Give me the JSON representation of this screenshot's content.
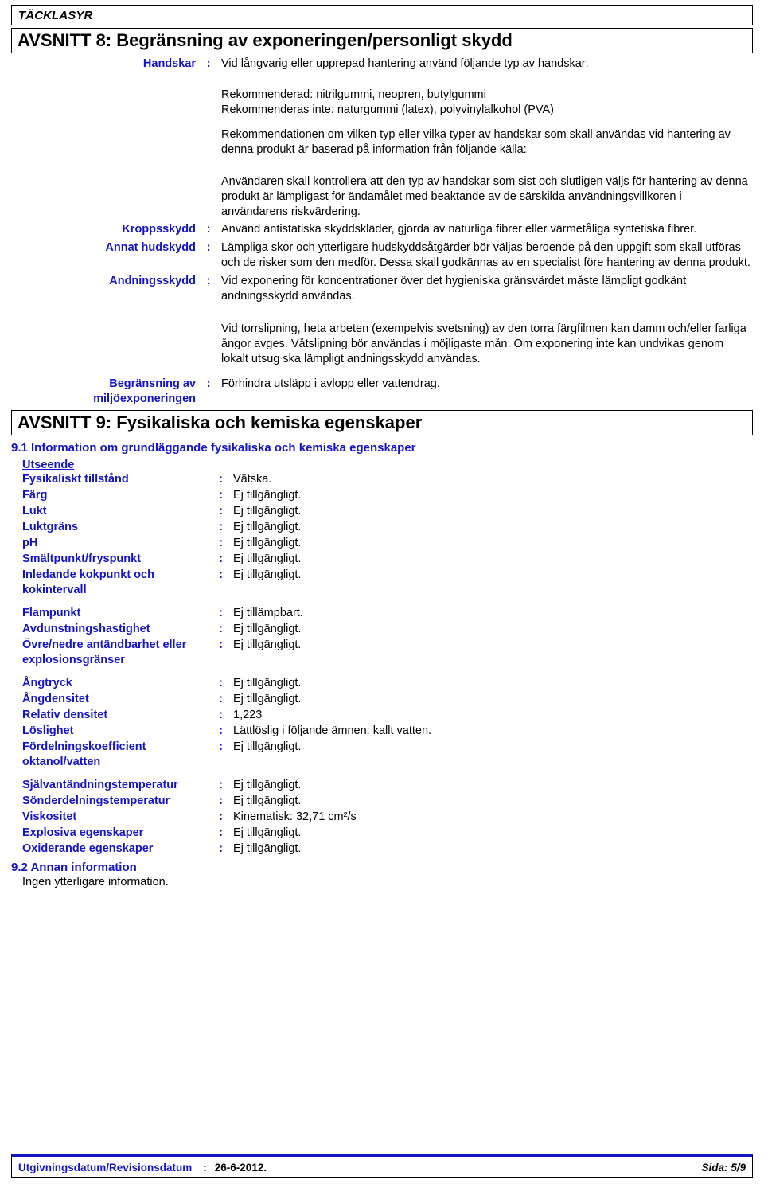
{
  "document": {
    "product_name": "TÄCKLASYR"
  },
  "section8": {
    "banner": "AVSNITT 8: Begränsning av exponeringen/personligt skydd",
    "colon": ":",
    "rows": [
      {
        "label": "Handskar",
        "value": "Vid långvarig eller upprepad hantering använd följande typ av handskar:"
      },
      {
        "label": "Kroppsskydd",
        "value": "Använd antistatiska skyddskläder, gjorda av naturliga fibrer eller värmetåliga syntetiska fibrer."
      },
      {
        "label": "Annat hudskydd",
        "value": "Lämpliga skor och ytterligare hudskyddsåtgärder bör väljas beroende på den uppgift som skall utföras och de risker som den medför. Dessa skall godkännas av en specialist före hantering av denna produkt."
      },
      {
        "label": "Andningsskydd",
        "value": "Vid exponering för koncentrationer över det hygieniska gränsvärdet måste lämpligt godkänt andningsskydd användas."
      },
      {
        "label": "Begränsning av miljöexponeringen",
        "value": "Förhindra utsläpp i avlopp eller vattendrag."
      }
    ],
    "handskar_note_1": "Rekommenderad: nitrilgummi, neopren, butylgummi\nRekommenderas inte: naturgummi (latex), polyvinylalkohol (PVA)",
    "handskar_note_2": "Rekommendationen om vilken typ eller vilka typer av handskar som skall användas vid hantering av denna produkt är baserad på information från följande källa:",
    "handskar_note_3": "Användaren skall kontrollera att den typ av handskar som sist och slutligen väljs för hantering av denna produkt är lämpligast för ändamålet med beaktande av de särskilda användningsvillkoren i användarens riskvärdering.",
    "andnings_note": "Vid torrslipning, heta arbeten (exempelvis svetsning) av den torra färgfilmen kan damm och/eller farliga ångor avges. Våtslipning bör användas i möjligaste mån. Om exponering inte kan undvikas genom lokalt utsug ska lämpligt andningsskydd användas."
  },
  "section9": {
    "banner": "AVSNITT 9: Fysikaliska och kemiska egenskaper",
    "subheading_91": "9.1 Information om grundläggande fysikaliska och kemiska egenskaper",
    "appearance_heading": "Utseende",
    "colon": ":",
    "properties": [
      {
        "label": "Fysikaliskt tillstånd",
        "value": "Vätska."
      },
      {
        "label": "Färg",
        "value": "Ej tillgängligt."
      },
      {
        "label": "Lukt",
        "value": "Ej tillgängligt."
      },
      {
        "label": "Luktgräns",
        "value": "Ej tillgängligt."
      },
      {
        "label": "pH",
        "value": "Ej tillgängligt."
      },
      {
        "label": "Smältpunkt/fryspunkt",
        "value": "Ej tillgängligt."
      },
      {
        "label": "Inledande kokpunkt och kokintervall",
        "value": "Ej tillgängligt."
      },
      {
        "label": "Flampunkt",
        "value": "Ej tillämpbart."
      },
      {
        "label": "Avdunstningshastighet",
        "value": "Ej tillgängligt."
      },
      {
        "label": "Övre/nedre antändbarhet eller explosionsgränser",
        "value": "Ej tillgängligt."
      },
      {
        "label": "Ångtryck",
        "value": "Ej tillgängligt."
      },
      {
        "label": "Ångdensitet",
        "value": "Ej tillgängligt."
      },
      {
        "label": "Relativ densitet",
        "value": "1,223"
      },
      {
        "label": "Löslighet",
        "value": "Lättlöslig i följande ämnen: kallt vatten."
      },
      {
        "label": "Fördelningskoefficient oktanol/vatten",
        "value": "Ej tillgängligt."
      },
      {
        "label": "Självantändningstemperatur",
        "value": "Ej tillgängligt."
      },
      {
        "label": "Sönderdelningstemperatur",
        "value": "Ej tillgängligt."
      },
      {
        "label": "Viskositet",
        "value": "Kinematisk: 32,71 cm²/s"
      },
      {
        "label": "Explosiva egenskaper",
        "value": "Ej tillgängligt."
      },
      {
        "label": "Oxiderande egenskaper",
        "value": "Ej tillgängligt."
      }
    ],
    "subheading_92": "9.2 Annan information",
    "other_info": "Ingen ytterligare information."
  },
  "footer": {
    "label": "Utgivningsdatum/Revisionsdatum",
    "colon": ":",
    "date": "26-6-2012.",
    "page": "Sida: 5/9"
  },
  "colors": {
    "label_blue": "#1414c8",
    "text_black": "#000000"
  }
}
